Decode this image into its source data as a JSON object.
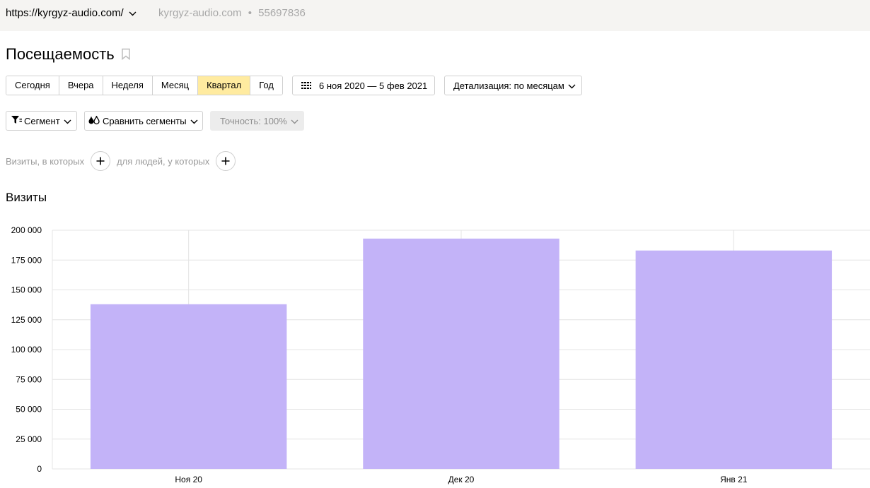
{
  "header": {
    "site_url": "https://kyrgyz-audio.com/",
    "site_domain": "kyrgyz-audio.com",
    "separator": "•",
    "counter_id": "55697836"
  },
  "page": {
    "title": "Посещаемость"
  },
  "period_buttons": [
    {
      "label": "Сегодня",
      "active": false
    },
    {
      "label": "Вчера",
      "active": false
    },
    {
      "label": "Неделя",
      "active": false
    },
    {
      "label": "Месяц",
      "active": false
    },
    {
      "label": "Квартал",
      "active": true
    },
    {
      "label": "Год",
      "active": false
    }
  ],
  "date_range": "6 ноя 2020 — 5 фев 2021",
  "detail_label": "Детализация: по месяцам",
  "segment_label": "Сегмент",
  "compare_label": "Сравнить сегменты",
  "accuracy_label": "Точность: 100%",
  "filters": {
    "visits_label": "Визиты, в которых",
    "people_label": "для людей, у которых"
  },
  "section": {
    "title": "Визиты"
  },
  "colors": {
    "bar": "#c3b3f8",
    "active_period": "#ffeba0",
    "topbar": "#f5f4f2"
  },
  "icons": {
    "site_dropdown": "chevron-down-icon",
    "bookmark": "bookmark-icon",
    "calendar": "calendar-grid-icon",
    "segment": "filter-funnel-icon",
    "compare": "compare-segments-icon",
    "add": "plus-icon"
  },
  "chart_data": {
    "type": "bar",
    "categories": [
      "Ноя 20",
      "Дек 20",
      "Янв 21"
    ],
    "values": [
      138000,
      193000,
      183000
    ],
    "ylim": [
      0,
      200000
    ],
    "yticks": [
      0,
      25000,
      50000,
      75000,
      100000,
      125000,
      150000,
      175000,
      200000
    ],
    "ytick_labels": [
      "0",
      "25 000",
      "50 000",
      "75 000",
      "100 000",
      "125 000",
      "150 000",
      "175 000",
      "200 000"
    ],
    "grid": true,
    "legend": "none"
  }
}
